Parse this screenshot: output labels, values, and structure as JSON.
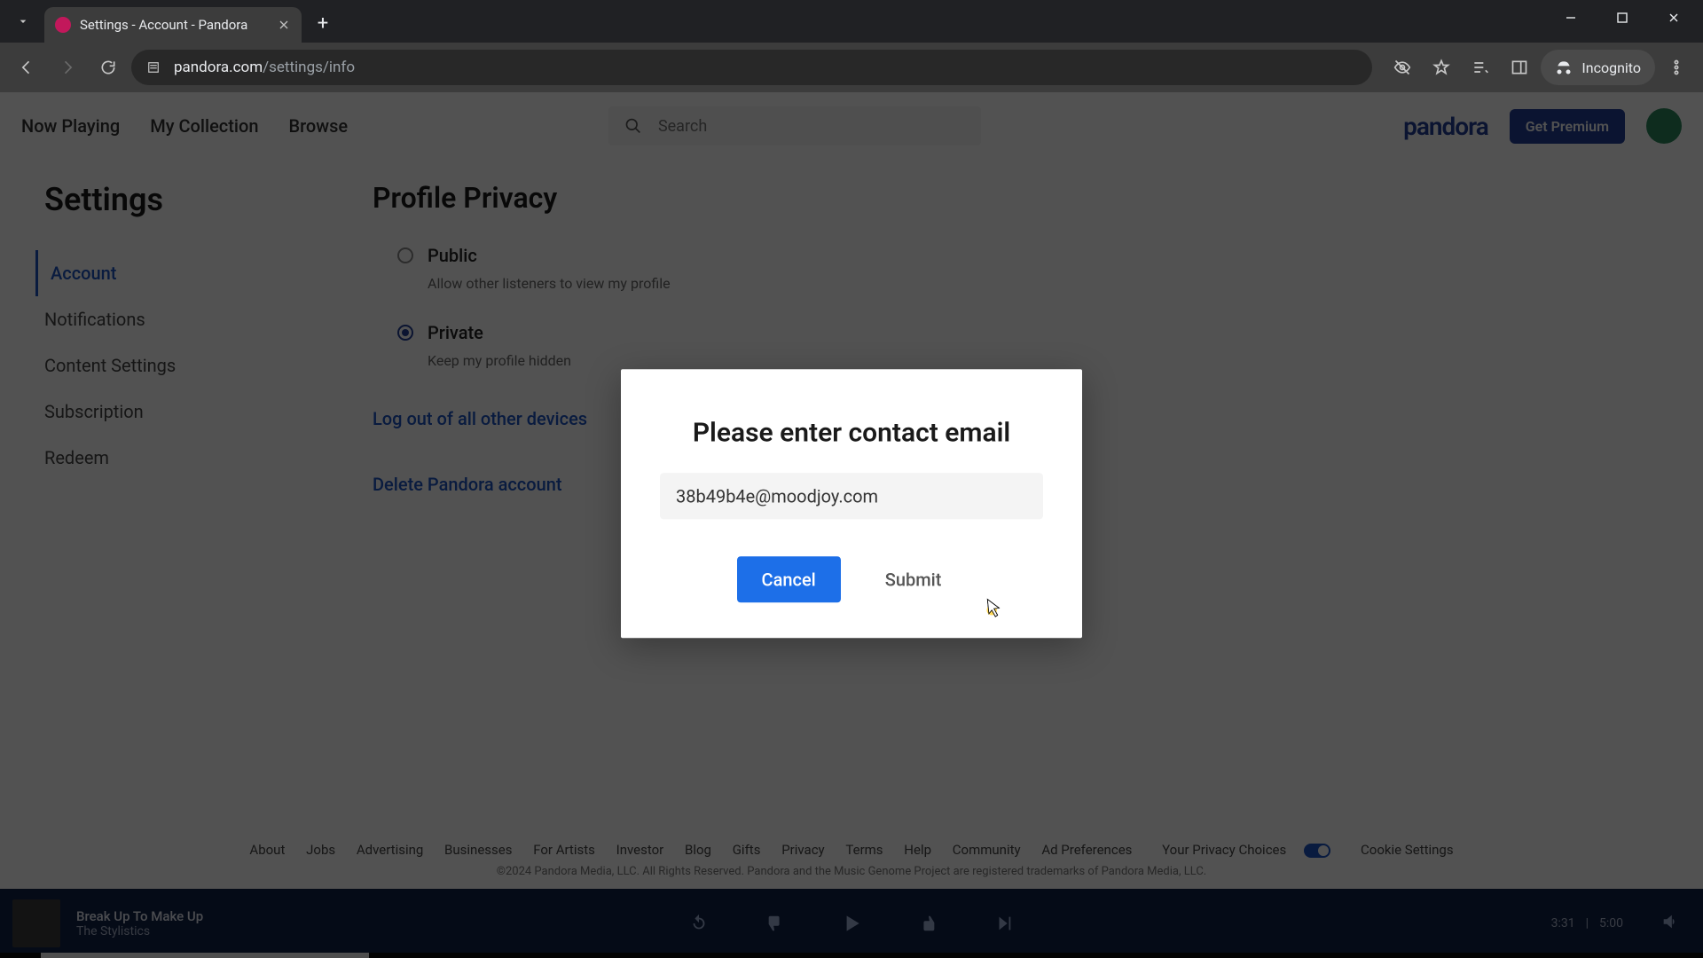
{
  "browser": {
    "tab_title": "Settings - Account - Pandora",
    "url_host": "pandora.com",
    "url_path": "/settings/info",
    "incognito_label": "Incognito"
  },
  "header": {
    "nav": [
      "Now Playing",
      "My Collection",
      "Browse"
    ],
    "search_placeholder": "Search",
    "logo": "pandora",
    "premium_button": "Get Premium"
  },
  "sidebar": {
    "title": "Settings",
    "items": [
      "Account",
      "Notifications",
      "Content Settings",
      "Subscription",
      "Redeem"
    ],
    "active_index": 0
  },
  "main": {
    "heading": "Profile Privacy",
    "options": [
      {
        "label": "Public",
        "desc": "Allow other listeners to view my profile",
        "selected": false
      },
      {
        "label": "Private",
        "desc": "Keep my profile hidden",
        "selected": true
      }
    ],
    "logout_link": "Log out of all other devices",
    "delete_link": "Delete Pandora account"
  },
  "modal": {
    "title": "Please enter contact email",
    "email_value": "38b49b4e@moodjoy.com",
    "cancel": "Cancel",
    "submit": "Submit"
  },
  "footer": {
    "links": [
      "About",
      "Jobs",
      "Advertising",
      "Businesses",
      "For Artists",
      "Investor",
      "Blog",
      "Gifts",
      "Privacy",
      "Terms",
      "Help",
      "Community",
      "Ad Preferences",
      "Your Privacy Choices",
      "Cookie Settings"
    ],
    "copyright": "©2024 Pandora Media, LLC. All Rights Reserved. Pandora and the Music Genome Project are registered trademarks of Pandora Media, LLC."
  },
  "player": {
    "track_title": "Break Up To Make Up",
    "track_artist": "The Stylistics",
    "time_current": "3:31",
    "time_total": "5:00"
  }
}
